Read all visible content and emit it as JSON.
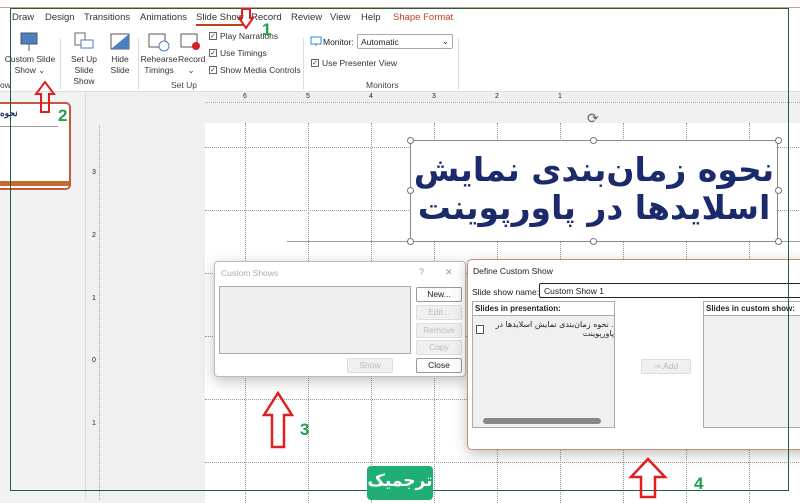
{
  "ribbon": {
    "tabs": [
      "Draw",
      "Design",
      "Transitions",
      "Animations",
      "Slide Show",
      "Record",
      "Review",
      "View",
      "Help",
      "Shape Format"
    ],
    "active_tab": "Slide Show",
    "custom_slide_show": "Custom Slide Show ⌄",
    "set_up_slide_show": "Set Up Slide Show",
    "hide_slide": "Hide Slide",
    "rehearse_timings": "Rehearse Timings",
    "record": "Record ⌄",
    "play_narrations": "Play Narrations",
    "use_timings": "Use Timings",
    "show_media_controls": "Show Media Controls",
    "monitor_label": "Monitor:",
    "monitor_value": "Automatic",
    "use_presenter_view": "Use Presenter View",
    "group_set_up": "Set Up",
    "group_monitors": "Monitors",
    "group_partial": "ow"
  },
  "ruler": {
    "top": [
      "6",
      "5",
      "4",
      "3",
      "2",
      "1"
    ],
    "left": [
      "3",
      "2",
      "1",
      "0",
      "1",
      "2"
    ]
  },
  "slide": {
    "title_line1": "نحوه زمان‌بندی نمایش",
    "title_line2": "اسلایدها در پاورپوینت",
    "thumb_text": "نحوه"
  },
  "custom_shows": {
    "title": "Custom Shows",
    "help": "?",
    "close_x": "✕",
    "new": "New...",
    "edit": "Edit...",
    "remove": "Remove",
    "copy": "Copy",
    "show": "Show",
    "close": "Close"
  },
  "define_custom_show": {
    "title": "Define Custom Show",
    "name_label": "Slide show name:",
    "name_value": "Custom Show 1",
    "slides_in_presentation": "Slides in presentation:",
    "slide_item": ". نحوه زمان‌بندی نمایش اسلایدها در پاورپوینت",
    "add": "Add",
    "slides_in_custom_show": "Slides in custom show:"
  },
  "annotations": {
    "n1": "1",
    "n2": "2",
    "n3": "3",
    "n4": "4"
  },
  "watermark": "ترجمیک",
  "colors": {
    "accent": "#c43e1c",
    "title_text": "#1b2a6b",
    "annotation_arrow": "#e02020",
    "annotation_number": "#22a04a",
    "frame": "#1d5e45",
    "watermark_bg": "#1fae74"
  }
}
